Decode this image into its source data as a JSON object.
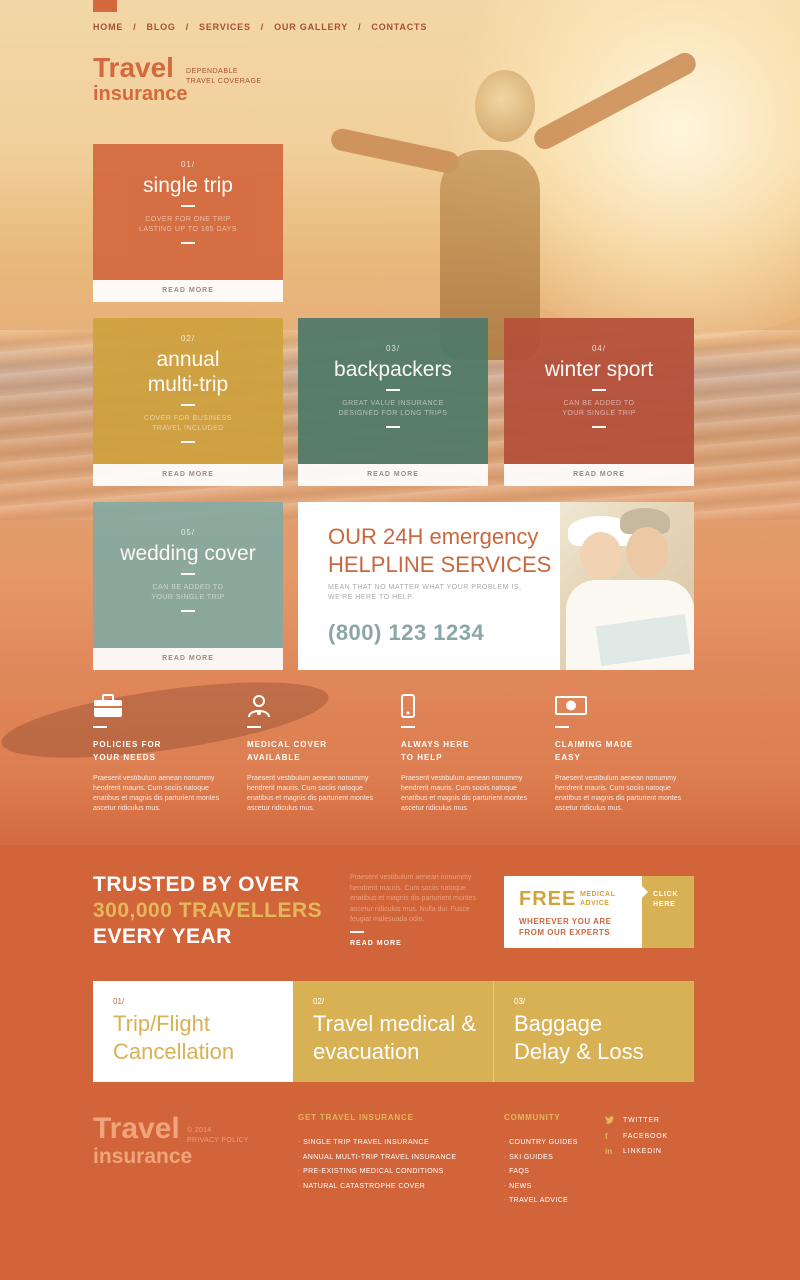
{
  "nav": {
    "items": [
      "HOME",
      "BLOG",
      "SERVICES",
      "OUR GALLERY",
      "CONTACTS"
    ],
    "separator": "/"
  },
  "logo": {
    "line1": "Travel",
    "line2": "insurance",
    "tagline": "DEPENDABLE TRAVEL COVERAGE"
  },
  "tiles": [
    {
      "num": "01/",
      "title": "single trip",
      "desc": "COVER FOR ONE TRIP LASTING UP TO 185 DAYS",
      "more": "READ MORE",
      "color": "#d4693e"
    },
    {
      "num": "02/",
      "title": "annual multi-trip",
      "desc": "COVER FOR BUSINESS TRAVEL INCLUDED",
      "more": "READ MORE",
      "color": "#cfa13e"
    },
    {
      "num": "03/",
      "title": "backpackers",
      "desc": "GREAT VALUE INSURANCE DESIGNED FOR LONG TRIPS",
      "more": "READ MORE",
      "color": "#4f7a67"
    },
    {
      "num": "04/",
      "title": "winter sport",
      "desc": "CAN BE ADDED TO YOUR SINGLE TRIP",
      "more": "READ MORE",
      "color": "#b5503a"
    },
    {
      "num": "05/",
      "title": "wedding cover",
      "desc": "CAN BE ADDED TO YOUR SINGLE TRIP",
      "more": "READ MORE",
      "color": "#86aaa2"
    }
  ],
  "helpline": {
    "line1_a": "OUR",
    "line1_b": "24H emergency",
    "line2": "HELPLINE SERVICES",
    "sub": "MEAN THAT NO MATTER WHAT YOUR PROBLEM IS, WE'RE HERE TO HELP.",
    "phone": "(800) 123 1234"
  },
  "features": [
    {
      "icon": "briefcase-icon",
      "title": "POLICIES FOR YOUR NEEDS",
      "text": "Praesent vestibulum aenean nonummy hendrerit mauris. Cum sociis natoque enatibus et magnis dis parturient montes ascetur ridiculus mus."
    },
    {
      "icon": "doctor-icon",
      "title": "MEDICAL COVER AVAILABLE",
      "text": "Praesent vestibulum aenean nonummy hendrerit mauris. Cum sociis natoque enatibus et magnis dis parturient montes ascetur ridiculus mus."
    },
    {
      "icon": "phone-icon",
      "title": "ALWAYS HERE TO HELP",
      "text": "Praesent vestibulum aenean nonummy hendrerit mauris. Cum sociis natoque enatibus et magnis dis parturient montes ascetur ridiculus mus."
    },
    {
      "icon": "money-icon",
      "title": "CLAIMING MADE EASY",
      "text": "Praesent vestibulum aenean nonummy hendrerit mauris. Cum sociis natoque enatibus et magnis dis parturient montes ascetur ridiculus mus."
    }
  ],
  "trusted": {
    "line1": "TRUSTED BY OVER",
    "line2": "300,000 TRAVELLERS",
    "line3": "EVERY YEAR",
    "text": "Praesent vestibulum aenean nonummy hendrerit mauris. Cum sociis natoque enatibus et magnis dis parturient montes ascetur ridiculus mus. Nulla dui. Fusce feugiat malesuada odio.",
    "more": "READ MORE"
  },
  "free": {
    "big": "FREE",
    "small": "MEDICAL ADVICE",
    "line": "WHEREVER YOU ARE FROM OUR EXPERTS",
    "click": "CLICK HERE"
  },
  "services": [
    {
      "num": "01/",
      "title": "Trip/Flight Cancellation"
    },
    {
      "num": "02/",
      "title": "Travel medical & evacuation"
    },
    {
      "num": "03/",
      "title": "Baggage Delay & Loss"
    }
  ],
  "footer": {
    "logo1": "Travel",
    "logo2": "insurance",
    "year": "© 2014",
    "privacy": "PRIVACY POLICY",
    "col1_head": "GET TRAVEL INSURANCE",
    "col1": [
      "SINGLE TRIP TRAVEL INSURANCE",
      "ANNUAL MULTI-TRIP TRAVEL INSURANCE",
      "PRE-EXISTING MEDICAL CONDITIONS",
      "NATURAL CATASTROPHE COVER"
    ],
    "col2_head": "COMMUNITY",
    "col2": [
      "COUNTRY GUIDES",
      "SKI GUIDES",
      "FAQS",
      "NEWS",
      "TRAVEL ADVICE"
    ],
    "social": [
      {
        "icon": "twitter-icon",
        "label": "TWITTER"
      },
      {
        "icon": "facebook-icon",
        "label": "FACEBOOK"
      },
      {
        "icon": "linkedin-icon",
        "label": "LINKEDIN"
      }
    ]
  }
}
